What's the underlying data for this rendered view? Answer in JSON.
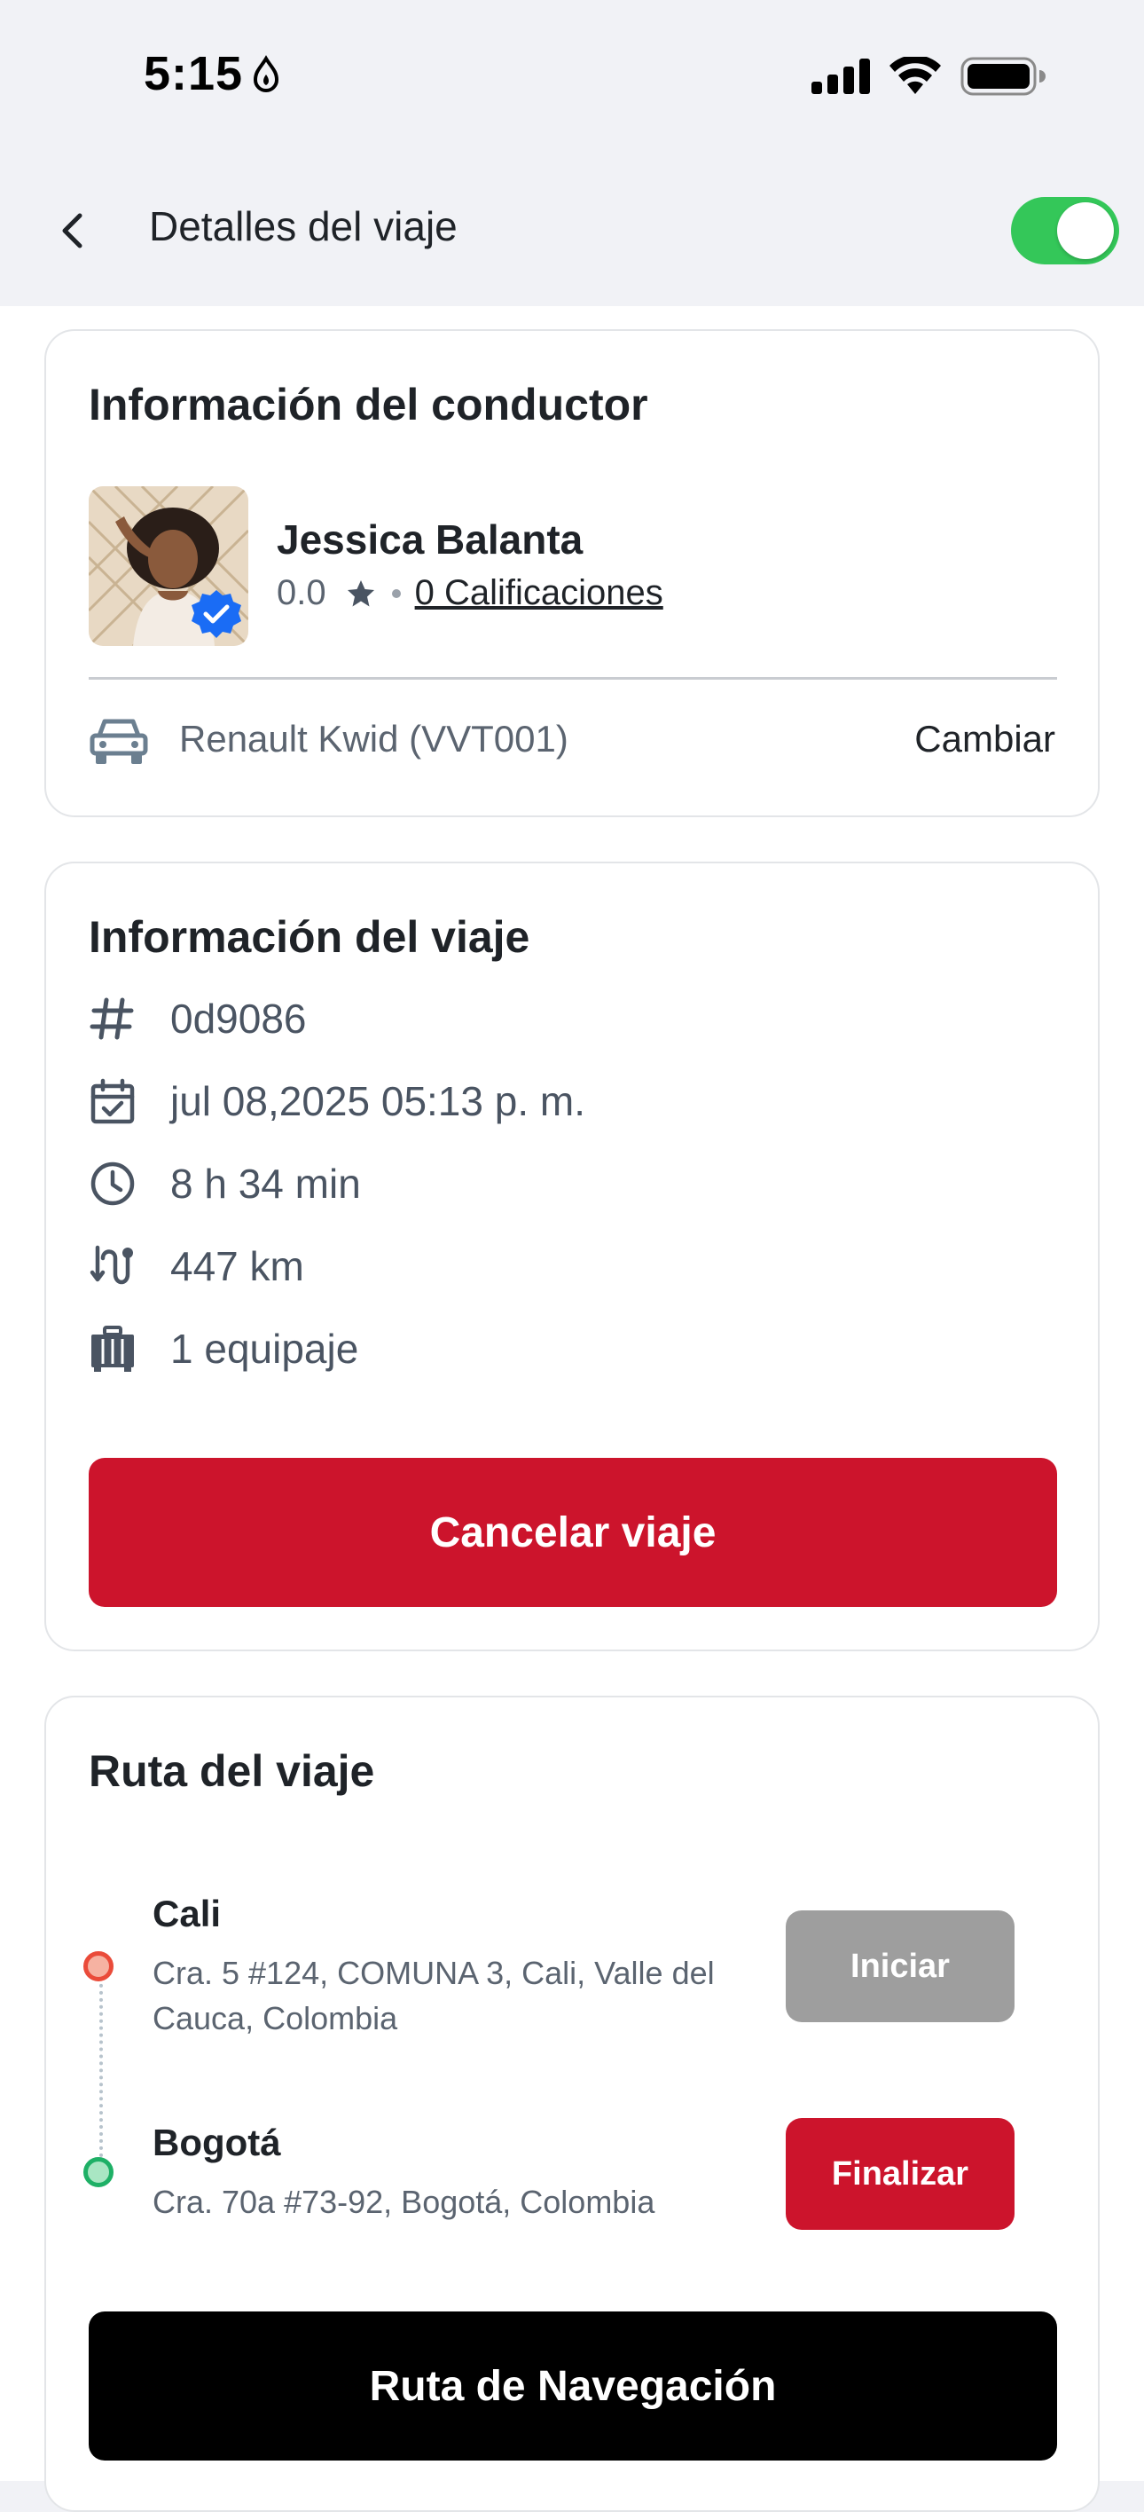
{
  "status_bar": {
    "time": "5:15"
  },
  "header": {
    "title": "Detalles del viaje",
    "toggle_on": true
  },
  "driver_card": {
    "title": "Información del conductor",
    "name": "Jessica Balanta",
    "rating": "0.0",
    "ratings_link": "0 Calificaciones",
    "vehicle": "Renault Kwid (VVT001)",
    "change_label": "Cambiar"
  },
  "trip_card": {
    "title": "Información del viaje",
    "trip_id": "0d9086",
    "date": "jul 08,2025 05:13 p. m.",
    "duration": "8 h 34 min",
    "distance": "447 km",
    "luggage": "1 equipaje",
    "cancel_label": "Cancelar viaje"
  },
  "route_card": {
    "title": "Ruta del viaje",
    "origin": {
      "city": "Cali",
      "address": "Cra. 5 #124, COMUNA 3, Cali, Valle del Cauca, Colombia",
      "button": "Iniciar"
    },
    "destination": {
      "city": "Bogotá",
      "address": "Cra. 70a #73-92, Bogotá, Colombia",
      "button": "Finalizar"
    },
    "nav_label": "Ruta de Navegación"
  },
  "colors": {
    "primary_red": "#cc142c",
    "toggle_green": "#34c759",
    "disabled_gray": "#9e9e9e",
    "origin_pin": "#ea4b3a",
    "destination_pin": "#1eb066"
  }
}
